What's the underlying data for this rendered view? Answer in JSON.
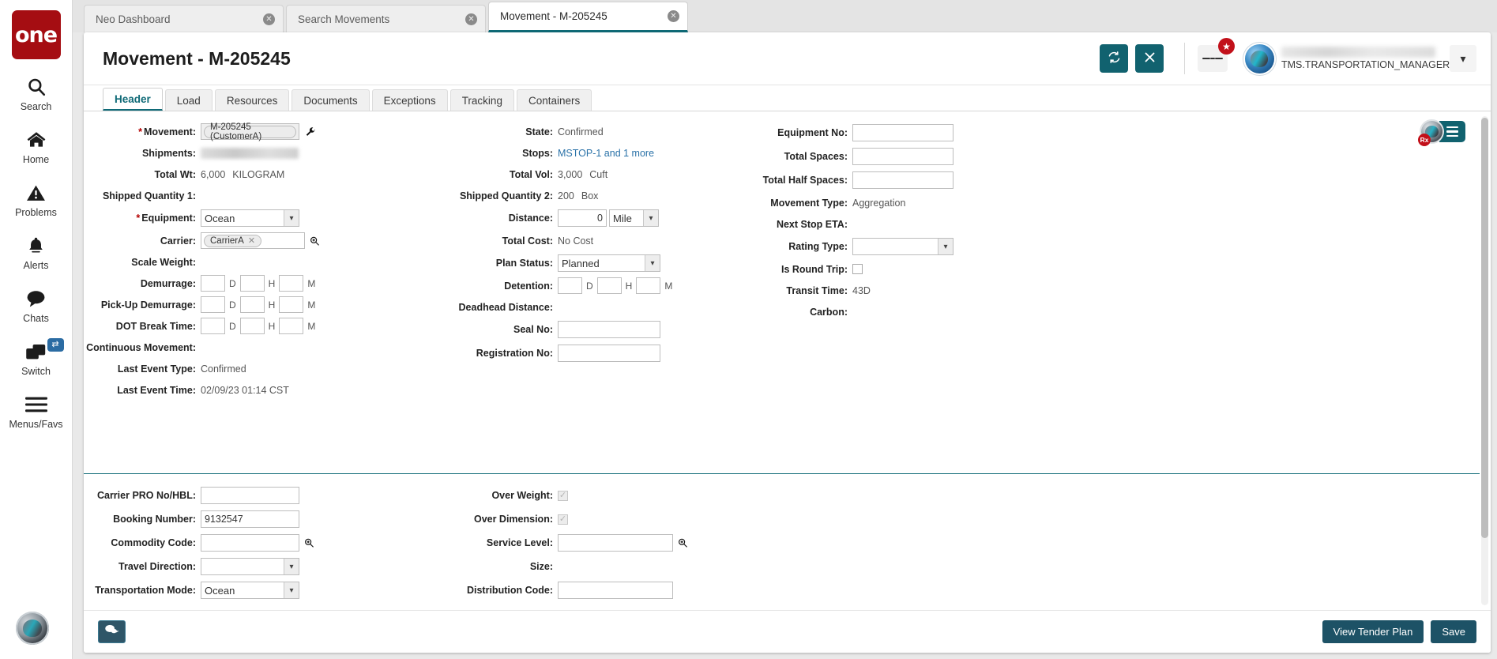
{
  "rail": {
    "logo": "one",
    "items": [
      {
        "label": "Search",
        "icon": "search-icon"
      },
      {
        "label": "Home",
        "icon": "home-icon"
      },
      {
        "label": "Problems",
        "icon": "warning-icon"
      },
      {
        "label": "Alerts",
        "icon": "bell-icon"
      },
      {
        "label": "Chats",
        "icon": "chat-icon"
      },
      {
        "label": "Switch",
        "icon": "switch-icon",
        "badge": "⇄"
      },
      {
        "label": "Menus/Favs",
        "icon": "menu-icon"
      }
    ]
  },
  "browser_tabs": [
    {
      "title": "Neo Dashboard",
      "active": false,
      "close": "✕"
    },
    {
      "title": "Search Movements",
      "active": false,
      "close": "✕"
    },
    {
      "title": "Movement - M-205245",
      "active": true,
      "close": "✕"
    }
  ],
  "header": {
    "title": "Movement - M-205245",
    "refresh_icon": "refresh-icon",
    "close_icon": "close-icon",
    "menu_icon": "hamburger-icon",
    "star_badge": "★",
    "user_name": "TMS.TRANSPORTATION_MANAGER",
    "caret": "▾"
  },
  "inner_tabs": [
    {
      "label": "Header",
      "active": true
    },
    {
      "label": "Load",
      "active": false
    },
    {
      "label": "Resources",
      "active": false
    },
    {
      "label": "Documents",
      "active": false
    },
    {
      "label": "Exceptions",
      "active": false
    },
    {
      "label": "Tracking",
      "active": false
    },
    {
      "label": "Containers",
      "active": false
    }
  ],
  "form": {
    "col1": {
      "movement_label": "Movement:",
      "movement_chip": "M-205245 (CustomerA)",
      "shipments_label": "Shipments:",
      "total_wt_label": "Total Wt:",
      "total_wt_value": "6,000",
      "total_wt_unit": "KILOGRAM",
      "shipped_qty1_label": "Shipped Quantity 1:",
      "equipment_label": "Equipment:",
      "equipment_value": "Ocean",
      "carrier_label": "Carrier:",
      "carrier_chip": "CarrierA",
      "scale_weight_label": "Scale Weight:",
      "demurrage_label": "Demurrage:",
      "pickup_demurrage_label": "Pick-Up Demurrage:",
      "dot_break_label": "DOT Break Time:",
      "continuous_movement_label": "Continuous Movement:",
      "last_event_type_label": "Last Event Type:",
      "last_event_type_value": "Confirmed",
      "last_event_time_label": "Last Event Time:",
      "last_event_time_value": "02/09/23 01:14 CST",
      "d": "D",
      "h": "H",
      "m": "M"
    },
    "col2": {
      "state_label": "State:",
      "state_value": "Confirmed",
      "stops_label": "Stops:",
      "stops_value": "MSTOP-1 and 1 more",
      "total_vol_label": "Total Vol:",
      "total_vol_value": "3,000",
      "total_vol_unit": "Cuft",
      "shipped_qty2_label": "Shipped Quantity 2:",
      "shipped_qty2_value": "200",
      "shipped_qty2_unit": "Box",
      "distance_label": "Distance:",
      "distance_value": "0",
      "distance_unit": "Mile",
      "total_cost_label": "Total Cost:",
      "total_cost_value": "No Cost",
      "plan_status_label": "Plan Status:",
      "plan_status_value": "Planned",
      "detention_label": "Detention:",
      "deadhead_label": "Deadhead Distance:",
      "seal_no_label": "Seal No:",
      "seal_no_value": "",
      "registration_no_label": "Registration No:",
      "registration_no_value": "",
      "d": "D",
      "h": "H",
      "m": "M"
    },
    "col3": {
      "equipment_no_label": "Equipment No:",
      "equipment_no_value": "",
      "total_spaces_label": "Total Spaces:",
      "total_spaces_value": "",
      "total_half_spaces_label": "Total Half Spaces:",
      "total_half_spaces_value": "",
      "movement_type_label": "Movement Type:",
      "movement_type_value": "Aggregation",
      "next_stop_eta_label": "Next Stop ETA:",
      "rating_type_label": "Rating Type:",
      "rating_type_value": "",
      "is_round_trip_label": "Is Round Trip:",
      "transit_time_label": "Transit Time:",
      "transit_time_value": "43D",
      "carbon_label": "Carbon:"
    },
    "panel2_col1": {
      "carrier_pro_label": "Carrier PRO No/HBL:",
      "carrier_pro_value": "",
      "booking_number_label": "Booking Number:",
      "booking_number_value": "9132547",
      "commodity_code_label": "Commodity Code:",
      "commodity_code_value": "",
      "travel_direction_label": "Travel Direction:",
      "travel_direction_value": "",
      "transportation_mode_label": "Transportation Mode:",
      "transportation_mode_value": "Ocean"
    },
    "panel2_col2": {
      "over_weight_label": "Over Weight:",
      "over_dimension_label": "Over Dimension:",
      "service_level_label": "Service Level:",
      "service_level_value": "",
      "size_label": "Size:",
      "distribution_code_label": "Distribution Code:",
      "distribution_code_value": ""
    }
  },
  "float_widget": {
    "rx_badge": "Rx",
    "menu_icon": "hamburger-icon"
  },
  "footer": {
    "chat_icon": "chat-bubble-icon",
    "view_tender_plan": "View Tender Plan",
    "save": "Save"
  },
  "colors": {
    "brand_red": "#a50d12",
    "teal": "#11626f",
    "link_blue": "#2a72a8",
    "required_red": "#b40000",
    "footer_btn": "#1d5266"
  }
}
